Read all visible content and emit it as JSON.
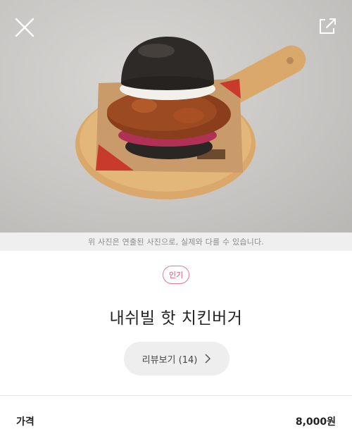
{
  "header": {
    "close_icon": "close-icon",
    "share_icon": "share-icon"
  },
  "hero": {
    "image": "black-bun-chicken-burger-on-wooden-board"
  },
  "disclaimer": "위 사진은 연출된 사진으로, 실제와 다를 수 있습니다.",
  "product": {
    "badge": "인기",
    "name": "내쉬빌 핫 치킨버거",
    "review_label": "리뷰보기 (14)",
    "review_chevron_icon": "chevron-right-icon"
  },
  "price": {
    "label": "가격",
    "value": "8,000원"
  },
  "colors": {
    "badge_accent": "#d4577a",
    "button_bg": "#eeeeee",
    "disclaimer_bg": "#efefef"
  }
}
